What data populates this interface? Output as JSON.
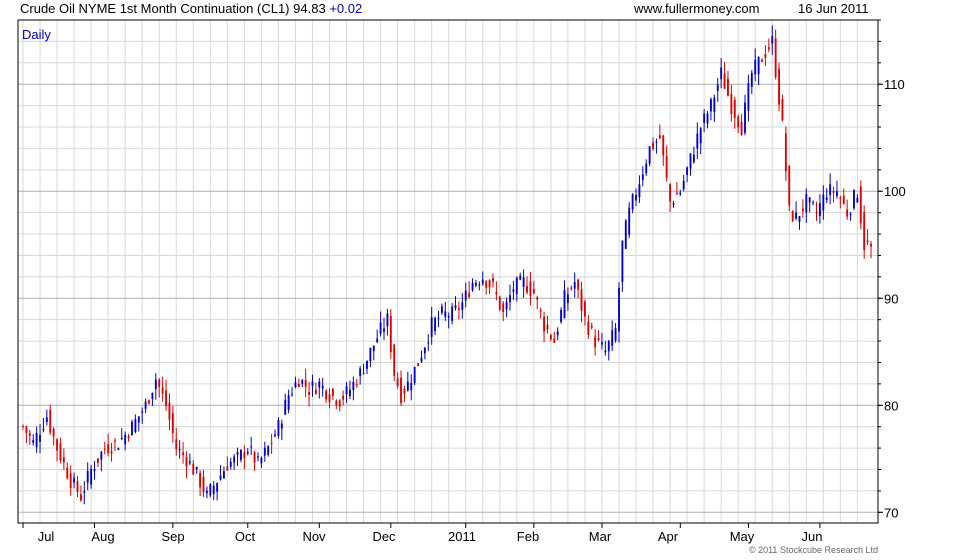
{
  "header": {
    "instrument": "Crude Oil NYME 1st Month Continuation (CL1)",
    "last": "94.83",
    "change": "+0.02",
    "source": "www.fullermoney.com",
    "date": "16 Jun 2011"
  },
  "period_label": "Daily",
  "copyright": "© 2011 Stockcube Research Ltd",
  "colors": {
    "up": "#0000cc",
    "down": "#dd0000",
    "grid": "#d8d8d8",
    "grid_major": "#b0b0b0",
    "axis": "#000000"
  },
  "chart_data": {
    "type": "candlestick",
    "period": "Daily",
    "title": "Crude Oil NYME 1st Month Continuation (CL1)",
    "x_tick_labels": [
      "Jul",
      "Aug",
      "Sep",
      "Oct",
      "Nov",
      "Dec",
      "2011",
      "Feb",
      "Mar",
      "Apr",
      "May",
      "Jun"
    ],
    "y_ticks": [
      70,
      80,
      90,
      100,
      110
    ],
    "ylim": [
      69,
      116
    ],
    "y_axis_position": "right",
    "grid": true,
    "close_path": [
      [
        0,
        78
      ],
      [
        3,
        76.5
      ],
      [
        7,
        79
      ],
      [
        10,
        76
      ],
      [
        14,
        73
      ],
      [
        17,
        71.5
      ],
      [
        20,
        74
      ],
      [
        24,
        76
      ],
      [
        28,
        76.5
      ],
      [
        32,
        78
      ],
      [
        36,
        80
      ],
      [
        39,
        82.5
      ],
      [
        42,
        80
      ],
      [
        45,
        76
      ],
      [
        48,
        75
      ],
      [
        51,
        73.5
      ],
      [
        54,
        71.5
      ],
      [
        57,
        73
      ],
      [
        60,
        74.5
      ],
      [
        63,
        75
      ],
      [
        66,
        76
      ],
      [
        69,
        74.5
      ],
      [
        72,
        76
      ],
      [
        75,
        78
      ],
      [
        78,
        81
      ],
      [
        81,
        82.5
      ],
      [
        84,
        81.5
      ],
      [
        87,
        82
      ],
      [
        90,
        81
      ],
      [
        93,
        80.5
      ],
      [
        96,
        81.5
      ],
      [
        99,
        83
      ],
      [
        102,
        85
      ],
      [
        105,
        87
      ],
      [
        107,
        88
      ],
      [
        109,
        83
      ],
      [
        111,
        81
      ],
      [
        113,
        82
      ],
      [
        116,
        84
      ],
      [
        120,
        87.5
      ],
      [
        123,
        88.5
      ],
      [
        126,
        88.5
      ],
      [
        129,
        89.5
      ],
      [
        132,
        91.5
      ],
      [
        135,
        92
      ],
      [
        138,
        91
      ],
      [
        141,
        88.5
      ],
      [
        144,
        91
      ],
      [
        147,
        91.5
      ],
      [
        150,
        90.5
      ],
      [
        153,
        87.5
      ],
      [
        156,
        86
      ],
      [
        159,
        90
      ],
      [
        162,
        91.5
      ],
      [
        165,
        88
      ],
      [
        168,
        86
      ],
      [
        171,
        85
      ],
      [
        174,
        87
      ],
      [
        176,
        95
      ],
      [
        178,
        98
      ],
      [
        181,
        101
      ],
      [
        184,
        104
      ],
      [
        187,
        105
      ],
      [
        190,
        99
      ],
      [
        193,
        100
      ],
      [
        196,
        103
      ],
      [
        199,
        106
      ],
      [
        202,
        108
      ],
      [
        205,
        111
      ],
      [
        208,
        108
      ],
      [
        211,
        106
      ],
      [
        214,
        111
      ],
      [
        217,
        112.5
      ],
      [
        220,
        114
      ],
      [
        223,
        106
      ],
      [
        225,
        98
      ],
      [
        227,
        97.5
      ],
      [
        230,
        99
      ],
      [
        233,
        98
      ],
      [
        236,
        100
      ],
      [
        239,
        100
      ],
      [
        242,
        98
      ],
      [
        245,
        100
      ],
      [
        247,
        95
      ],
      [
        249,
        94.83
      ]
    ]
  }
}
